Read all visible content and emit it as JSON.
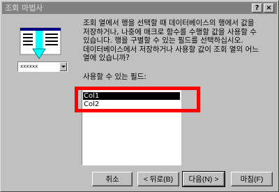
{
  "window": {
    "title": "조회 마법사",
    "help_glyph": "?",
    "close_glyph": "×"
  },
  "illustration": {
    "icon": "table-lookup-illustration",
    "combo_value": "xxxxxx"
  },
  "description": "조회 열에서 행을 선택할 때 데이터베이스의 행에서 값을 저장하거나, 나중에 매크로 함수를 수행할 값을 사용할 수 있습니다. 행을 구별할 수 있는 필드를 선택하십시오. 데이터베이스에서 저장하거나 사용할 값이 조회 열의 어느 열에 있습니까?",
  "fields": {
    "label": "사용할 수 있는 필드:",
    "items": [
      "Col1",
      "Col2"
    ],
    "selected_index": 0
  },
  "buttons": {
    "cancel": "취소",
    "back": "< 뒤로(B)",
    "next": "다음(N) >",
    "finish": "마침(F)"
  },
  "colors": {
    "highlight": "#ff0000",
    "selection_bg": "#000000",
    "window_bg": "#c0c0c0",
    "titlebar": "#808080"
  }
}
